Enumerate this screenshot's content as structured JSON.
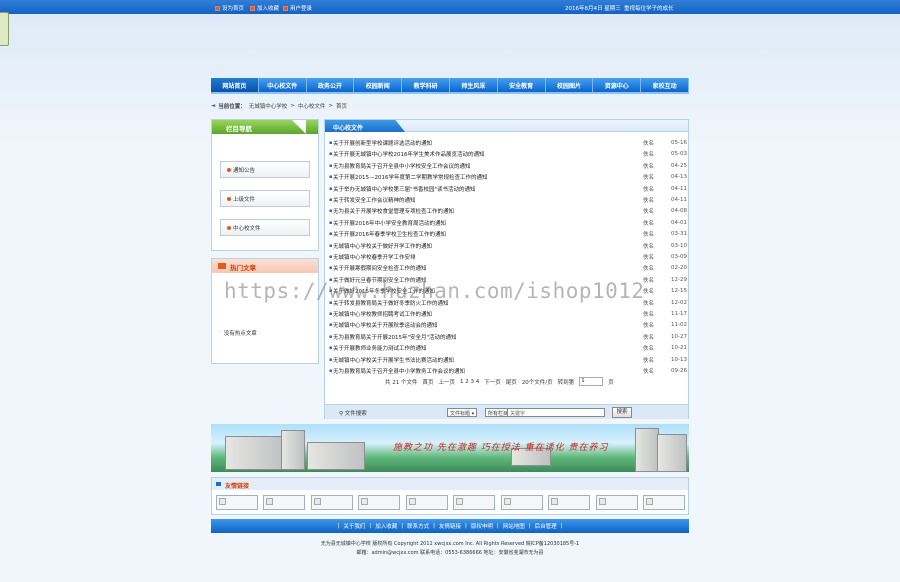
{
  "top": {
    "links": [
      "设为首页",
      "加入收藏",
      "用户登录"
    ],
    "date": "2016年8月4日 星期三",
    "motto": "重视每位学子的成长"
  },
  "nav": [
    "网站首页",
    "中心校文件",
    "政务公开",
    "校园新闻",
    "教学科研",
    "师生风采",
    "安全教育",
    "校园图片",
    "资源中心",
    "家校互动"
  ],
  "breadcrumb": {
    "label": "当前位置：",
    "path": [
      "无城镇中心学校",
      "中心校文件",
      "首页"
    ]
  },
  "left_nav": {
    "title": "栏目导航",
    "items": [
      "通知公告",
      "上级文件",
      "中心校文件"
    ]
  },
  "hot": {
    "title": "热门文章",
    "items": [
      "没有热点文章"
    ]
  },
  "content": {
    "title": "中心校文件",
    "articles": [
      {
        "title": "关于开展创新型学校课题评选活动的通知",
        "author": "佚名",
        "date": "05-16"
      },
      {
        "title": "关于开展无城镇中心学校2016年学生美术作品展览活动的通知",
        "author": "佚名",
        "date": "05-03"
      },
      {
        "title": "无为县教育局关于召开全县中小学校安全工作会议的通知",
        "author": "佚名",
        "date": "04-25"
      },
      {
        "title": "关于开展2015—2016学年度第二学期教学常规检查工作的通知",
        "author": "佚名",
        "date": "04-13"
      },
      {
        "title": "关于举办无城镇中心学校第三届\"书香校园\"读书活动的通知",
        "author": "佚名",
        "date": "04-11"
      },
      {
        "title": "关于转发安全工作会议精神的通知",
        "author": "佚名",
        "date": "04-11"
      },
      {
        "title": "无为县关于开展学校食堂管理专项检查工作的通知",
        "author": "佚名",
        "date": "04-08"
      },
      {
        "title": "关于开展2016年中小学安全教育周活动的通知",
        "author": "佚名",
        "date": "04-01"
      },
      {
        "title": "关于开展2016年春季学校卫生检查工作的通知",
        "author": "佚名",
        "date": "03-31"
      },
      {
        "title": "无城镇中心学校关于做好开学工作的通知",
        "author": "佚名",
        "date": "03-10"
      },
      {
        "title": "无城镇中心学校春季开学工作安排",
        "author": "佚名",
        "date": "03-09"
      },
      {
        "title": "关于开展寒假期间安全检查工作的通知",
        "author": "佚名",
        "date": "02-20"
      },
      {
        "title": "关于做好元旦春节期间安全工作的通知",
        "author": "佚名",
        "date": "12-29"
      },
      {
        "title": "关于做好2015年冬季学校安全工作的通知",
        "author": "佚名",
        "date": "12-15"
      },
      {
        "title": "关于转发县教育局关于做好冬季防火工作的通知",
        "author": "佚名",
        "date": "12-02"
      },
      {
        "title": "无城镇中心学校教师招聘考试工作的通知",
        "author": "佚名",
        "date": "11-17"
      },
      {
        "title": "无城镇中心学校关于开展秋季运动会的通知",
        "author": "佚名",
        "date": "11-02"
      },
      {
        "title": "无为县教育局关于开展2015年\"安全月\"活动的通知",
        "author": "佚名",
        "date": "10-27"
      },
      {
        "title": "关于开展教师业务能力测试工作的通知",
        "author": "佚名",
        "date": "10-21"
      },
      {
        "title": "无城镇中心学校关于开展学生书法比赛活动的通知",
        "author": "佚名",
        "date": "10-13"
      },
      {
        "title": "无为县教育局关于召开全县中小学教务工作会议的通知",
        "author": "佚名",
        "date": "09-26"
      }
    ],
    "pager": {
      "stats": "共 21 个文件",
      "first": "首页",
      "prev": "上一页",
      "pages": "1 2 3 4",
      "next": "下一页",
      "last": "尾页",
      "per_page": "20个文件/页",
      "goto_label": "转到第",
      "goto_value": "1",
      "goto_suffix": "页"
    },
    "search": {
      "label": "文件搜索",
      "field": "文件标题",
      "scope": "所有栏目",
      "placeholder": "关键字",
      "button": "搜索"
    }
  },
  "banner": {
    "slogan": "施教之功 先在激趣 巧在授法 重在诱化 贵在养习"
  },
  "links": {
    "title": "友情链接"
  },
  "footer_nav": [
    "关于我们",
    "加入收藏",
    "联系方式",
    "友情链接",
    "版权申明",
    "网站地图",
    "后台管理"
  ],
  "footer": {
    "line1": "无为县无城镇中心学校 版权所有 Copyright 2011 xwcjxx.com Inc. All Rights Reserved 皖ICP备12030185号-1",
    "line2": "邮箱：admin@wcjxx.com 联系电话：0553-6386666 地址：安徽省芜湖市无为县"
  },
  "watermark": "https://www.huzhan.com/ishop1012"
}
